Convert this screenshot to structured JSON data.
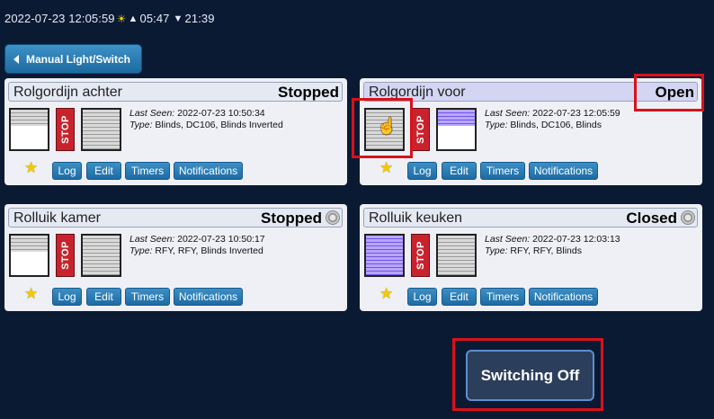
{
  "topbar": {
    "datetime": "2022-07-23 12:05:59",
    "sunrise": "05:47",
    "sunset": "21:39",
    "sun_icon": "☀",
    "up_icon": "▲",
    "down_icon": "▼"
  },
  "back_button": {
    "label": "Manual Light/Switch"
  },
  "devices": [
    {
      "name": "Rolgordijn achter",
      "status": "Stopped",
      "last_seen_label": "Last Seen:",
      "last_seen": "2022-07-23 10:50:34",
      "type_label": "Type:",
      "type": "Blinds, DC106, Blinds Inverted",
      "stop_label": "STOP",
      "buttons": [
        "Log",
        "Edit",
        "Timers",
        "Notifications"
      ]
    },
    {
      "name": "Rolgordijn voor",
      "status": "Open",
      "last_seen_label": "Last Seen:",
      "last_seen": "2022-07-23 12:05:59",
      "type_label": "Type:",
      "type": "Blinds, DC106, Blinds",
      "stop_label": "STOP",
      "buttons": [
        "Log",
        "Edit",
        "Timers",
        "Notifications"
      ]
    },
    {
      "name": "Rolluik kamer",
      "status": "Stopped",
      "last_seen_label": "Last Seen:",
      "last_seen": "2022-07-23 10:50:17",
      "type_label": "Type:",
      "type": "RFY, RFY, Blinds Inverted",
      "stop_label": "STOP",
      "buttons": [
        "Log",
        "Edit",
        "Timers",
        "Notifications"
      ]
    },
    {
      "name": "Rolluik keuken",
      "status": "Closed",
      "last_seen_label": "Last Seen:",
      "last_seen": "2022-07-23 12:03:13",
      "type_label": "Type:",
      "type": "RFY, RFY, Blinds",
      "stop_label": "STOP",
      "buttons": [
        "Log",
        "Edit",
        "Timers",
        "Notifications"
      ]
    }
  ],
  "notification": {
    "label": "Switching Off"
  },
  "colors": {
    "background": "#0b1a33",
    "button": "#1f6ba3",
    "stop": "#c8232c",
    "highlight": "#d8121a",
    "favorite": "#f3c900"
  }
}
